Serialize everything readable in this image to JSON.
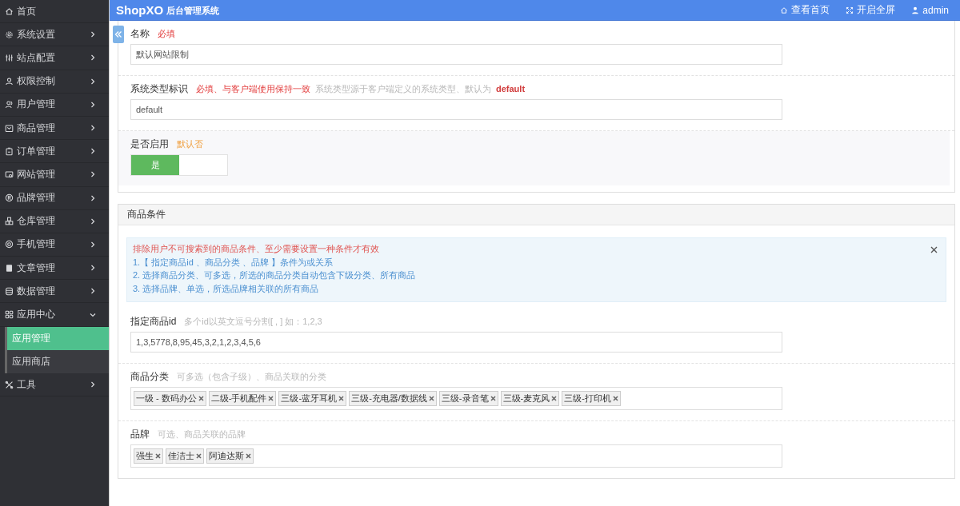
{
  "topbar": {
    "logo": "ShopXO",
    "subtitle": "后台管理系统",
    "links": [
      {
        "label": "查看首页"
      },
      {
        "label": "开启全屏"
      },
      {
        "label": "admin"
      }
    ]
  },
  "sidebar": {
    "items": [
      {
        "kind": "link",
        "label": "首页"
      },
      {
        "kind": "menu",
        "label": "系统设置",
        "expanded": false
      },
      {
        "kind": "menu",
        "label": "站点配置",
        "expanded": false
      },
      {
        "kind": "menu",
        "label": "权限控制",
        "expanded": false
      },
      {
        "kind": "menu",
        "label": "用户管理",
        "expanded": false
      },
      {
        "kind": "menu",
        "label": "商品管理",
        "expanded": false
      },
      {
        "kind": "menu",
        "label": "订单管理",
        "expanded": false
      },
      {
        "kind": "menu",
        "label": "网站管理",
        "expanded": false
      },
      {
        "kind": "menu",
        "label": "品牌管理",
        "expanded": false
      },
      {
        "kind": "menu",
        "label": "仓库管理",
        "expanded": false
      },
      {
        "kind": "menu",
        "label": "手机管理",
        "expanded": false
      },
      {
        "kind": "menu",
        "label": "文章管理",
        "expanded": false
      },
      {
        "kind": "menu",
        "label": "数据管理",
        "expanded": false
      },
      {
        "kind": "menu",
        "label": "应用中心",
        "expanded": true,
        "children": [
          {
            "label": "应用管理",
            "selected": true
          },
          {
            "label": "应用商店",
            "selected": false
          }
        ]
      },
      {
        "kind": "menu",
        "label": "工具",
        "expanded": false
      }
    ]
  },
  "panels": [
    {
      "fields": [
        {
          "kind": "text",
          "label": "名称",
          "notes": [
            {
              "kind": "required",
              "text": "必填"
            }
          ],
          "value": "默认网站限制"
        },
        {
          "kind": "text",
          "label": "系统类型标识",
          "notes": [
            {
              "kind": "required",
              "text": "必填、与客户端使用保持一致"
            },
            {
              "kind": "hint",
              "text": "系统类型源于客户端定义的系统类型、默认为"
            },
            {
              "kind": "code",
              "text": "default"
            }
          ],
          "value": "default"
        },
        {
          "kind": "switch",
          "label": "是否启用",
          "notes": [
            {
              "kind": "default",
              "text": "默认否"
            }
          ],
          "on": true,
          "on_label": "是"
        }
      ]
    },
    {
      "title": "商品条件",
      "alert": {
        "lines": [
          {
            "kind": "warning",
            "text": "排除用户不可搜索到的商品条件、至少需要设置一种条件才有效"
          },
          {
            "kind": "info",
            "text": "1.【 指定商品id 、商品分类 、品牌 】条件为或关系"
          },
          {
            "kind": "info",
            "text": "2. 选择商品分类、可多选，所选的商品分类自动包含下级分类、所有商品"
          },
          {
            "kind": "info",
            "text": "3. 选择品牌、单选，所选品牌相关联的所有商品"
          }
        ]
      },
      "fields": [
        {
          "kind": "text",
          "label": "指定商品id",
          "notes": [
            {
              "kind": "hint",
              "text": "多个id以英文逗号分割[ , ] 如：1,2,3"
            }
          ],
          "value": "1,3,5778,8,95,45,3,2,1,2,3,4,5,6"
        },
        {
          "kind": "tags",
          "label": "商品分类",
          "notes": [
            {
              "kind": "hint",
              "text": "可多选（包含子级）、商品关联的分类"
            }
          ],
          "tags": [
            "一级 - 数码办公",
            "二级-手机配件",
            "三级-蓝牙耳机",
            "三级-充电器/数据线",
            "三级-录音笔",
            "三级-麦克风",
            "三级-打印机"
          ]
        },
        {
          "kind": "tags",
          "label": "品牌",
          "notes": [
            {
              "kind": "hint",
              "text": "可选、商品关联的品牌"
            }
          ],
          "tags": [
            "强生",
            "佳洁士",
            "阿迪达斯"
          ]
        }
      ]
    }
  ]
}
